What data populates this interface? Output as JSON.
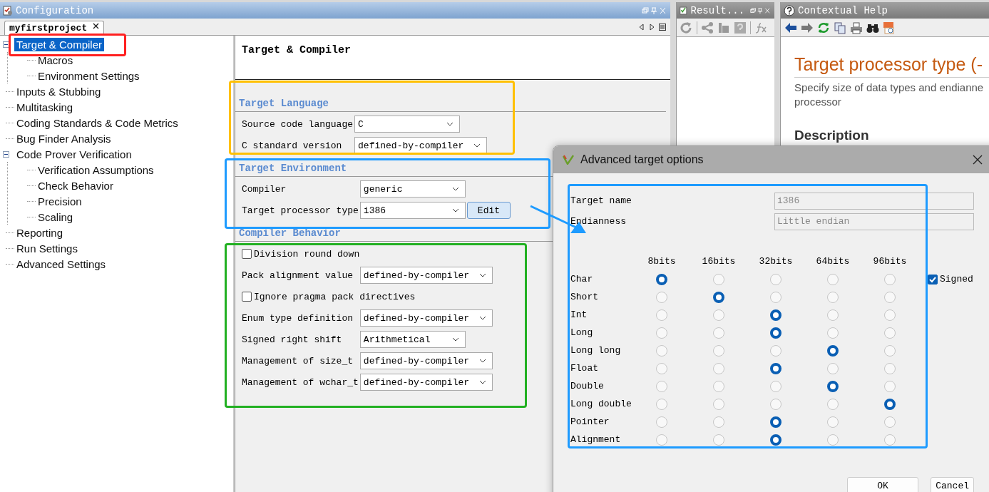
{
  "config_panel": {
    "title": "Configuration",
    "tab": {
      "label": "myfirstproject",
      "selected": true
    }
  },
  "tree": [
    {
      "label": "Target & Compiler",
      "selected": true,
      "expanded": true,
      "children": [
        {
          "label": "Macros",
          "selected": false
        },
        {
          "label": "Environment Settings",
          "selected": false
        }
      ]
    },
    {
      "label": "Inputs & Stubbing",
      "selected": false
    },
    {
      "label": "Multitasking",
      "selected": false
    },
    {
      "label": "Coding Standards & Code Metrics",
      "selected": false
    },
    {
      "label": "Bug Finder Analysis",
      "selected": false
    },
    {
      "label": "Code Prover Verification",
      "selected": false,
      "expanded": true,
      "children": [
        {
          "label": "Verification Assumptions",
          "selected": false
        },
        {
          "label": "Check Behavior",
          "selected": false
        },
        {
          "label": "Precision",
          "selected": false
        },
        {
          "label": "Scaling",
          "selected": false
        }
      ]
    },
    {
      "label": "Reporting",
      "selected": false
    },
    {
      "label": "Run Settings",
      "selected": false
    },
    {
      "label": "Advanced Settings",
      "selected": false
    }
  ],
  "form": {
    "title": "Target & Compiler",
    "sections": [
      {
        "title": "Target Language",
        "rows": [
          {
            "kind": "dropdown",
            "label": "Source code language",
            "value": "C"
          },
          {
            "kind": "dropdown",
            "label": "C standard version",
            "value": "defined-by-compiler"
          }
        ]
      },
      {
        "title": "Target Environment",
        "rows": [
          {
            "kind": "dropdown",
            "label": "Compiler",
            "value": "generic"
          },
          {
            "kind": "dropdown",
            "label": "Target processor type",
            "value": "i386",
            "button": "Edit"
          }
        ]
      },
      {
        "title": "Compiler Behavior",
        "rows": [
          {
            "kind": "checkbox",
            "label": "Division round down",
            "checked": false
          },
          {
            "kind": "dropdown",
            "label": "Pack alignment value",
            "value": "defined-by-compiler"
          },
          {
            "kind": "checkbox",
            "label": "Ignore pragma pack directives",
            "checked": false
          },
          {
            "kind": "dropdown",
            "label": "Enum type definition",
            "value": "defined-by-compiler"
          },
          {
            "kind": "dropdown",
            "label": "Signed right shift",
            "value": "Arithmetical"
          },
          {
            "kind": "dropdown",
            "label": "Management of size_t",
            "value": "defined-by-compiler"
          },
          {
            "kind": "dropdown",
            "label": "Management of wchar_t",
            "value": "defined-by-compiler"
          }
        ]
      }
    ]
  },
  "results_panel": {
    "title": "Result..."
  },
  "help_panel": {
    "title": "Contextual Help",
    "heading": "Target processor type (-",
    "summary_lines": [
      "Specify size of data types and endianne",
      "processor"
    ],
    "subheading": "Description"
  },
  "dialog": {
    "title": "Advanced target options",
    "fields": [
      {
        "label": "Target name",
        "value": "i386",
        "disabled": true
      },
      {
        "label": "Endianness",
        "value": "Little endian",
        "disabled": true
      }
    ],
    "columns": [
      "8bits",
      "16bits",
      "32bits",
      "64bits",
      "96bits"
    ],
    "types": [
      {
        "label": "Char",
        "choices": [
          {
            "selected": true
          },
          {
            "selected": false
          },
          {
            "selected": false
          },
          {
            "selected": false
          },
          {
            "selected": false
          }
        ]
      },
      {
        "label": "Short",
        "choices": [
          {
            "selected": false
          },
          {
            "selected": true
          },
          {
            "selected": false
          },
          {
            "selected": false
          },
          {
            "selected": false
          }
        ]
      },
      {
        "label": "Int",
        "choices": [
          {
            "selected": false
          },
          {
            "selected": false
          },
          {
            "selected": true
          },
          {
            "selected": false
          },
          {
            "selected": false
          }
        ]
      },
      {
        "label": "Long",
        "choices": [
          {
            "selected": false
          },
          {
            "selected": false
          },
          {
            "selected": true
          },
          {
            "selected": false
          },
          {
            "selected": false
          }
        ]
      },
      {
        "label": "Long long",
        "choices": [
          {
            "selected": false
          },
          {
            "selected": false
          },
          {
            "selected": false
          },
          {
            "selected": true
          },
          {
            "selected": false
          }
        ]
      },
      {
        "label": "Float",
        "choices": [
          {
            "selected": false
          },
          {
            "selected": false
          },
          {
            "selected": true
          },
          {
            "selected": false
          },
          {
            "selected": false
          }
        ]
      },
      {
        "label": "Double",
        "choices": [
          {
            "selected": false
          },
          {
            "selected": false
          },
          {
            "selected": false
          },
          {
            "selected": true
          },
          {
            "selected": false
          }
        ]
      },
      {
        "label": "Long double",
        "choices": [
          {
            "selected": false
          },
          {
            "selected": false
          },
          {
            "selected": false
          },
          {
            "selected": false
          },
          {
            "selected": true
          }
        ]
      },
      {
        "label": "Pointer",
        "choices": [
          {
            "selected": false
          },
          {
            "selected": false
          },
          {
            "selected": true
          },
          {
            "selected": false
          },
          {
            "selected": false
          }
        ]
      },
      {
        "label": "Alignment",
        "choices": [
          {
            "selected": false
          },
          {
            "selected": false
          },
          {
            "selected": true
          },
          {
            "selected": false
          },
          {
            "selected": false
          }
        ]
      }
    ],
    "signed": {
      "label": "Signed",
      "checked": true
    },
    "buttons": [
      "OK",
      "Cancel"
    ]
  },
  "annotations": [
    {
      "kind": "frame",
      "color": "#ff2020"
    },
    {
      "kind": "frame",
      "color": "#ffc000"
    },
    {
      "kind": "frame",
      "color": "#1e9bff"
    },
    {
      "kind": "frame",
      "color": "#22b022"
    },
    {
      "kind": "frame",
      "color": "#1e9bff"
    },
    {
      "kind": "arrow",
      "color": "#1e9bff"
    }
  ]
}
